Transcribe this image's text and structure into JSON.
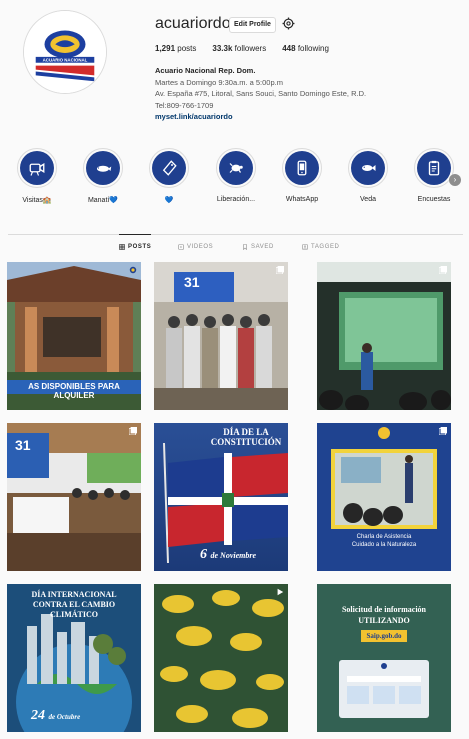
{
  "profile": {
    "username": "acuariordo",
    "edit_label": "Edit Profile",
    "posts_count": "1,291",
    "posts_label": "posts",
    "followers_count": "33.3k",
    "followers_label": "followers",
    "following_count": "448",
    "following_label": "following",
    "full_name": "Acuario Nacional Rep. Dom.",
    "hours": "Martes a Domingo 9:30a.m. a 5:00p.m",
    "address": "Av. España #75, Litoral, Sans Souci, Santo Domingo Este, R.D.",
    "phone": "Tel:809-766-1709",
    "link": "myset.link/acuariordo",
    "logo_text": "ACUARIO NACIONAL"
  },
  "highlights": [
    {
      "label": "Visitas",
      "badge": "🏫",
      "icon": "camera-icon"
    },
    {
      "label": "Manatí",
      "badge": "💙",
      "icon": "manatee-icon"
    },
    {
      "label": "",
      "badge": "💙",
      "icon": "tag-icon"
    },
    {
      "label": "Liberación...",
      "badge": "",
      "icon": "turtle-icon"
    },
    {
      "label": "WhatsApp",
      "badge": "",
      "icon": "phone-icon"
    },
    {
      "label": "Veda",
      "badge": "",
      "icon": "fish-icon"
    },
    {
      "label": "Encuestas",
      "badge": "",
      "icon": "clipboard-icon"
    }
  ],
  "tabs": [
    {
      "label": "POSTS",
      "icon": "grid-icon",
      "active": true
    },
    {
      "label": "VIDEOS",
      "icon": "video-icon",
      "active": false
    },
    {
      "label": "SAVED",
      "icon": "bookmark-icon",
      "active": false
    },
    {
      "label": "TAGGED",
      "icon": "tag-person-icon",
      "active": false
    }
  ],
  "posts": {
    "p1_caption": "AS DISPONIBLES PARA ALQUILER",
    "p2_caption": "31",
    "p4_caption": "31",
    "p5_title_1": "DÍA DE LA",
    "p5_title_2": "CONSTITUCIÓN",
    "p5_date_num": "6",
    "p5_date_txt": "de Noviembre",
    "p6_caption_1": "Charla de Asistencia",
    "p6_caption_2": "Cuidado a la Naturaleza",
    "p7_title_1": "DÍA INTERNACIONAL",
    "p7_title_2": "CONTRA EL CAMBIO",
    "p7_title_3": "CLIMÁTICO",
    "p7_date_num": "24",
    "p7_date_txt": "de Octubre",
    "p9_title_1": "Solicitud de información",
    "p9_title_2": "UTILIZANDO",
    "p9_title_3": "Saip.gob.do"
  },
  "colors": {
    "accent_blue": "#1f3f8f",
    "link_blue": "#00376b",
    "border": "#dbdbdb"
  }
}
